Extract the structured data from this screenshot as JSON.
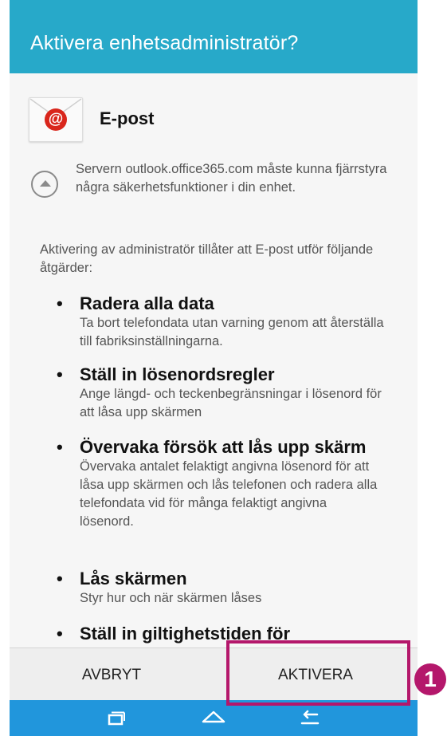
{
  "dialog": {
    "title": "Aktivera enhetsadministratör?",
    "app_name": "E-post",
    "app_icon": "email-at-icon",
    "server_notice": "Servern outlook.office365.com måste kunna fjärrstyra några säkerhetsfunktioner i din enhet.",
    "intro": "Aktivering av administratör tillåter att E-post utför följande åtgärder:",
    "permissions": [
      {
        "title": "Radera alla data",
        "description": "Ta bort telefondata utan varning genom att återställa till fabriksinställningarna."
      },
      {
        "title": "Ställ in lösenordsregler",
        "description": "Ange längd- och teckenbegränsningar i lösenord för att låsa upp skärmen"
      },
      {
        "title": "Övervaka försök att lås upp skärm",
        "description": "Övervaka antalet felaktigt angivna lösenord för att låsa upp skärmen och lås telefonen och radera alla telefondata vid för många felaktigt angivna lösenord."
      },
      {
        "title": "Lås skärmen",
        "description": "Styr hur och när skärmen låses"
      },
      {
        "title": "Ställ in giltighetstiden för",
        "description": ""
      }
    ],
    "buttons": {
      "cancel": "AVBRYT",
      "activate": "AKTIVERA"
    }
  },
  "nav_bar": {
    "items": [
      "recent-apps-icon",
      "home-icon",
      "back-icon"
    ]
  },
  "annotation": {
    "badge_label": "1"
  },
  "colors": {
    "title_bar": "#27a9c9",
    "nav_bar": "#2196dc",
    "highlight": "#b4176b",
    "email_icon": "#d9261c"
  }
}
